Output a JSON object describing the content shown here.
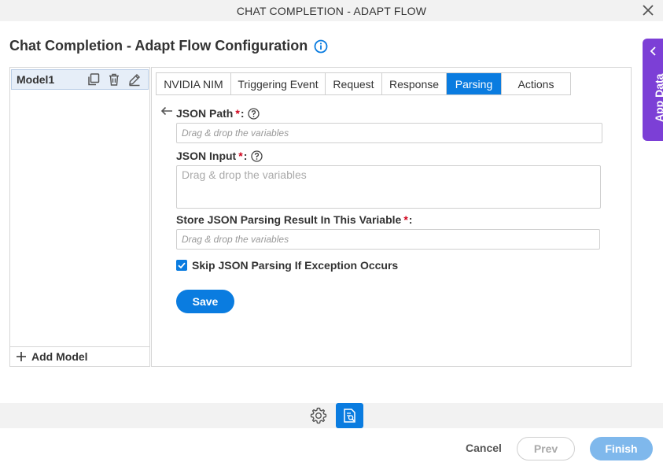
{
  "window": {
    "title": "CHAT COMPLETION - ADAPT FLOW",
    "close_icon": "close-icon"
  },
  "header": {
    "title": "Chat Completion - Adapt Flow Configuration",
    "info_icon": "info-icon"
  },
  "app_data": {
    "label": "App Data",
    "icon": "chevron-left-icon",
    "color": "#7c3fd6"
  },
  "models": {
    "items": [
      {
        "name": "Model1"
      }
    ],
    "actions": [
      "copy-icon",
      "delete-icon",
      "edit-icon"
    ],
    "add_label": "Add Model"
  },
  "tabs": [
    {
      "label": "NVIDIA NIM",
      "active": false
    },
    {
      "label": "Triggering Event",
      "active": false
    },
    {
      "label": "Request",
      "active": false
    },
    {
      "label": "Response",
      "active": false
    },
    {
      "label": "Parsing",
      "active": true
    },
    {
      "label": "Actions",
      "active": false
    }
  ],
  "form": {
    "json_path": {
      "label": "JSON Path",
      "required": "*",
      "colon": ":",
      "placeholder": "Drag & drop the variables",
      "value": ""
    },
    "json_input": {
      "label": "JSON Input",
      "required": "*",
      "colon": ":",
      "placeholder": "Drag & drop the variables",
      "value": ""
    },
    "store_result": {
      "label": "Store JSON Parsing Result In This Variable",
      "required": "*",
      "colon": ":",
      "placeholder": "Drag & drop the variables",
      "value": ""
    },
    "skip_exception": {
      "label": "Skip JSON Parsing If Exception Occurs",
      "checked": true
    },
    "save_label": "Save"
  },
  "footer": {
    "cancel_label": "Cancel",
    "prev_label": "Prev",
    "finish_label": "Finish"
  },
  "colors": {
    "accent": "#0a7ce0",
    "required": "#d0021b",
    "finish_disabled": "#7fb8ec"
  }
}
